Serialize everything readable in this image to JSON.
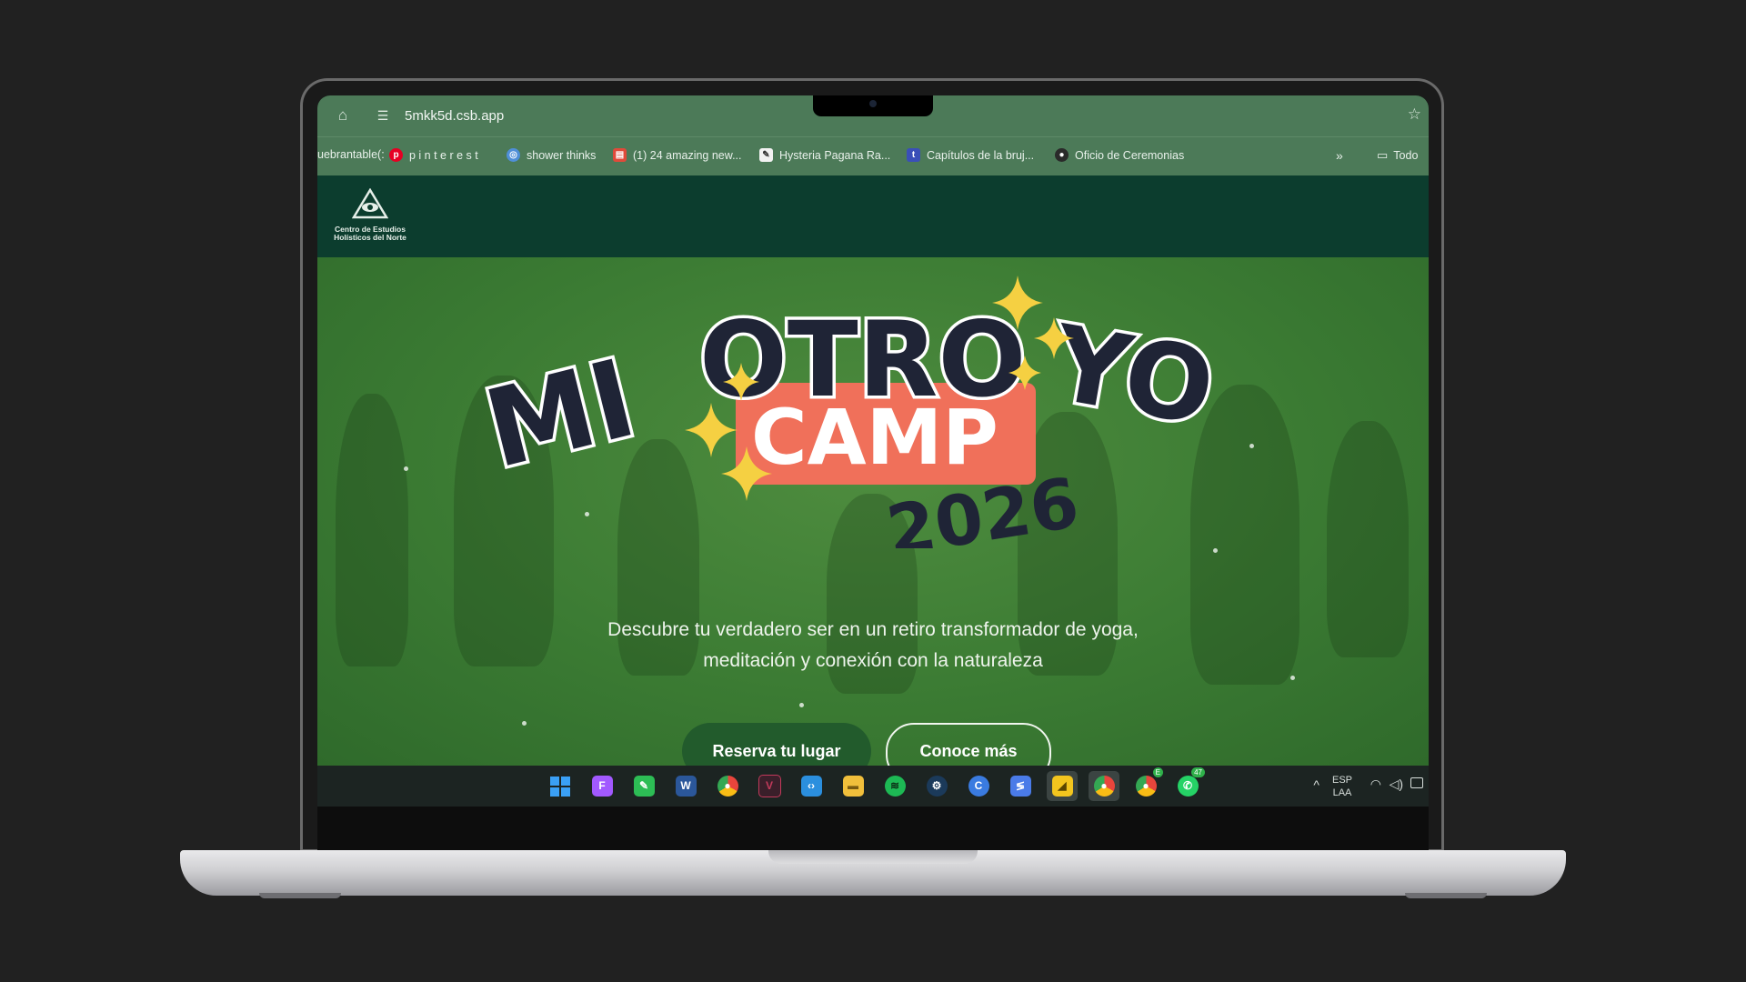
{
  "browser": {
    "url": "5mkk5d.csb.app",
    "bookmarks": [
      {
        "label": "uebrantable(:",
        "icon": "none"
      },
      {
        "label": "p i n t e r e s t",
        "icon": "pinterest-icon"
      },
      {
        "label": "shower thinks",
        "icon": "globe-icon"
      },
      {
        "label": "(1) 24 amazing new...",
        "icon": "gift-icon"
      },
      {
        "label": "Hysteria Pagana Ra...",
        "icon": "page-icon"
      },
      {
        "label": "Capítulos de la bruj...",
        "icon": "tumblr-icon"
      },
      {
        "label": "Oficio de Ceremonias",
        "icon": "bookmark-icon"
      }
    ],
    "overflow_label": "»",
    "folder_label": "Todo"
  },
  "site": {
    "logo_line1": "Centro de Estudios",
    "logo_line2": "Holísticos del Norte"
  },
  "hero": {
    "title_part1": "MI",
    "title_part2": "OTRO",
    "title_part3": "YO",
    "camp": "CAMP",
    "year": "2026",
    "description_line1": "Descubre tu verdadero ser en un retiro transformador de yoga,",
    "description_line2": "meditación y conexión con la naturaleza",
    "primary_button": "Reserva tu lugar",
    "secondary_button": "Conoce más"
  },
  "taskbar": {
    "apps": [
      {
        "name": "windows-start-icon",
        "color": "#3aa0f5"
      },
      {
        "name": "figma-icon",
        "color": "#a259ff"
      },
      {
        "name": "phone-link-icon",
        "color": "#2dbd55"
      },
      {
        "name": "word-icon",
        "color": "#2b579a"
      },
      {
        "name": "chrome-icon",
        "color": "#e8453c"
      },
      {
        "name": "vectorworks-icon",
        "color": "#c23a5b"
      },
      {
        "name": "vscode-icon",
        "color": "#2b8fde"
      },
      {
        "name": "file-explorer-icon",
        "color": "#f1bf3b"
      },
      {
        "name": "spotify-icon",
        "color": "#1db954"
      },
      {
        "name": "steam-icon",
        "color": "#4b8ec7"
      },
      {
        "name": "copilot-icon",
        "color": "#3a7be0"
      },
      {
        "name": "affinity-icon",
        "color": "#4a7be8"
      },
      {
        "name": "sticky-notes-icon",
        "color": "#f3c51e"
      },
      {
        "name": "chrome-profile-icon",
        "color": "#e8453c"
      },
      {
        "name": "chrome-second-profile-icon",
        "color": "#e8453c"
      },
      {
        "name": "whatsapp-icon",
        "color": "#25d366"
      }
    ],
    "whatsapp_badge": "47",
    "chrome_badge": "E",
    "lang_line1": "ESP",
    "lang_line2": "LAA"
  },
  "colors": {
    "header_green": "#0c3d2e",
    "hero_green": "#3b7b33",
    "camp_coral": "#f0705a",
    "title_navy": "#1f2436",
    "sparkle_yellow": "#f5d042"
  }
}
